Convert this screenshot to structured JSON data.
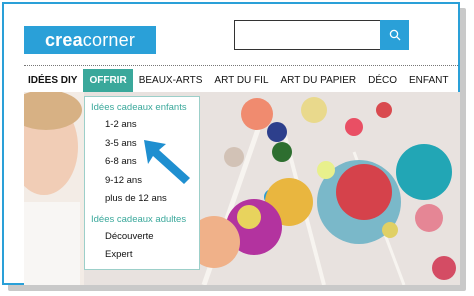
{
  "header": {
    "logo_bold": "crea",
    "logo_light": "corner",
    "search_value": ""
  },
  "nav": {
    "items": [
      "IDÉES DIY",
      "OFFRIR",
      "BEAUX-ARTS",
      "ART DU FIL",
      "ART DU PAPIER",
      "DÉCO",
      "ENFANT"
    ]
  },
  "dropdown": {
    "section1": "Idées cadeaux enfants",
    "kids": [
      "1-2 ans",
      "3-5 ans",
      "6-8 ans",
      "9-12 ans",
      "plus de 12 ans"
    ],
    "section2": "Idées cadeaux adultes",
    "adults": [
      "Découverte",
      "Expert"
    ]
  },
  "colors": {
    "brand": "#2aa0d8",
    "accent": "#3aa89b",
    "arrow": "#1f8fd0"
  },
  "icons": {
    "search": "search-icon",
    "pointer": "arrow-pointer-icon"
  }
}
